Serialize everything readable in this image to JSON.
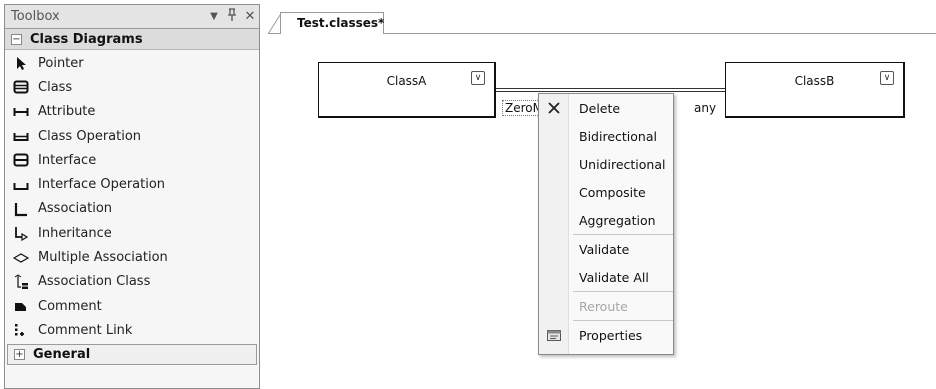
{
  "toolbox": {
    "title": "Toolbox",
    "controls": {
      "dropdown": "▾",
      "pin": "ᵖ",
      "close": "✕"
    },
    "section": {
      "expander": "⊟",
      "label": "Class Diagrams"
    },
    "items": [
      {
        "label": "Pointer",
        "icon": "pointer-icon"
      },
      {
        "label": "Class",
        "icon": "class-icon"
      },
      {
        "label": "Attribute",
        "icon": "attribute-icon"
      },
      {
        "label": "Class Operation",
        "icon": "class-operation-icon"
      },
      {
        "label": "Interface",
        "icon": "interface-icon"
      },
      {
        "label": "Interface Operation",
        "icon": "interface-operation-icon"
      },
      {
        "label": "Association",
        "icon": "association-icon"
      },
      {
        "label": "Inheritance",
        "icon": "inheritance-icon"
      },
      {
        "label": "Multiple Association",
        "icon": "multiple-association-icon"
      },
      {
        "label": "Association Class",
        "icon": "association-class-icon"
      },
      {
        "label": "Comment",
        "icon": "comment-icon"
      },
      {
        "label": "Comment Link",
        "icon": "comment-link-icon"
      }
    ],
    "general": {
      "expander": "⊞",
      "label": "General"
    }
  },
  "document": {
    "tab_label": "Test.classes*"
  },
  "diagram": {
    "class_a": {
      "name": "ClassA",
      "chevron": "≚"
    },
    "class_b": {
      "name": "ClassB",
      "chevron": "≚"
    },
    "multiplicity_left": "ZeroM",
    "multiplicity_right": "any"
  },
  "context_menu": {
    "items": [
      {
        "label": "Delete",
        "icon": "delete-icon",
        "disabled": false
      },
      {
        "label": "Bidirectional",
        "disabled": false
      },
      {
        "label": "Unidirectional",
        "disabled": false
      },
      {
        "label": "Composite",
        "disabled": false
      },
      {
        "label": "Aggregation",
        "disabled": false
      },
      {
        "label": "Validate",
        "disabled": false
      },
      {
        "label": "Validate All",
        "disabled": false
      },
      {
        "label": "Reroute",
        "disabled": true
      },
      {
        "label": "Properties",
        "icon": "properties-icon",
        "disabled": false
      }
    ]
  }
}
